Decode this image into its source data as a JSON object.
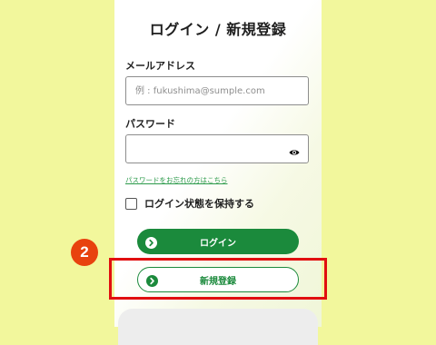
{
  "header": {
    "title": "ログイン / 新規登録"
  },
  "form": {
    "email_label": "メールアドレス",
    "email_placeholder": "例 : fukushima@sumple.com",
    "email_value": "",
    "password_label": "パスワード",
    "password_value": "",
    "forgot_link": "パスワードをお忘れの方はこちら",
    "remember_label": "ログイン状態を保持する",
    "remember_checked": false
  },
  "buttons": {
    "login_label": "ログイン",
    "register_label": "新規登録"
  },
  "annotation": {
    "step_number": "2"
  },
  "colors": {
    "background": "#f2f79c",
    "brand_green": "#1b8a3c",
    "highlight_red": "#e10f10",
    "badge_orange": "#e8420e"
  },
  "icons": {
    "password_toggle": "eye-icon",
    "button_arrow": "chevron-right-circle-icon"
  }
}
